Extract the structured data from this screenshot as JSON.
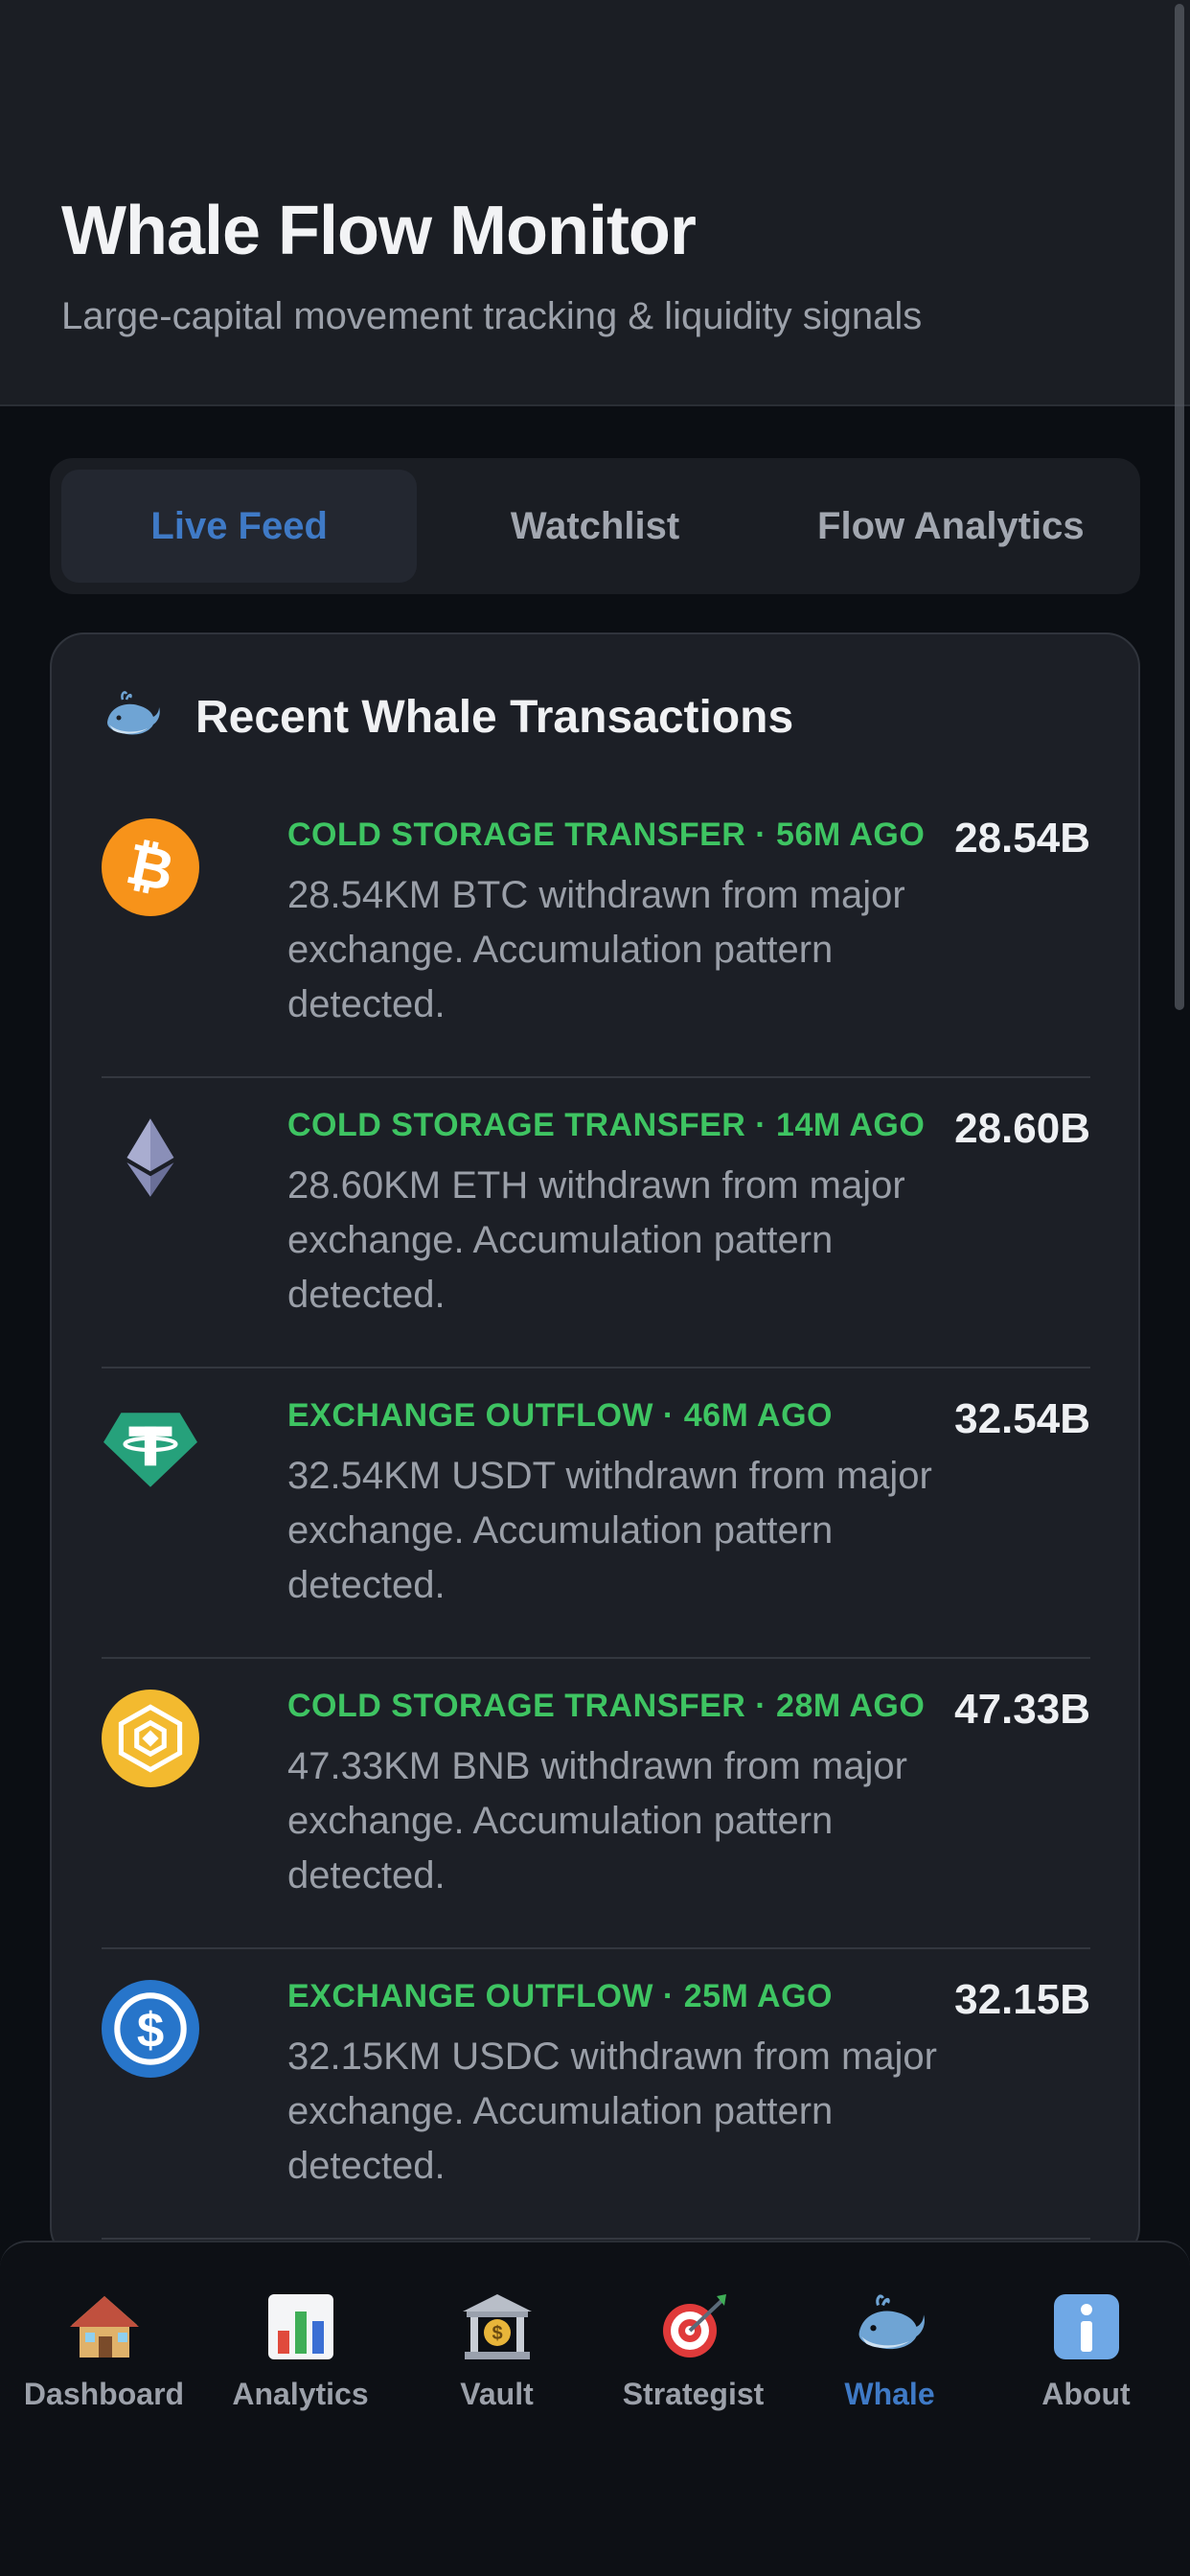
{
  "header": {
    "title": "Whale Flow Monitor",
    "subtitle": "Large-capital movement tracking & liquidity signals"
  },
  "tabs": [
    {
      "label": "Live Feed",
      "active": true
    },
    {
      "label": "Watchlist",
      "active": false
    },
    {
      "label": "Flow Analytics",
      "active": false
    }
  ],
  "card": {
    "title": "Recent Whale Transactions",
    "icon": "whale-icon"
  },
  "transactions": [
    {
      "coin": "btc",
      "icon": "bitcoin-icon",
      "meta": "COLD STORAGE TRANSFER · 56M AGO",
      "desc": "28.54KM BTC withdrawn from major exchange. Accumulation pattern detected.",
      "amount": "28.54B"
    },
    {
      "coin": "eth",
      "icon": "ethereum-icon",
      "meta": "COLD STORAGE TRANSFER · 14M AGO",
      "desc": "28.60KM ETH withdrawn from major exchange. Accumulation pattern detected.",
      "amount": "28.60B"
    },
    {
      "coin": "usdt",
      "icon": "tether-icon",
      "meta": "EXCHANGE OUTFLOW · 46M AGO",
      "desc": "32.54KM USDT withdrawn from major exchange. Accumulation pattern detected.",
      "amount": "32.54B"
    },
    {
      "coin": "bnb",
      "icon": "bnb-icon",
      "meta": "COLD STORAGE TRANSFER · 28M AGO",
      "desc": "47.33KM BNB withdrawn from major exchange. Accumulation pattern detected.",
      "amount": "47.33B"
    },
    {
      "coin": "usdc",
      "icon": "usdc-icon",
      "meta": "EXCHANGE OUTFLOW · 25M AGO",
      "desc": "32.15KM USDC withdrawn from major exchange. Accumulation pattern detected.",
      "amount": "32.15B"
    }
  ],
  "nav": [
    {
      "label": "Dashboard",
      "icon": "house-icon",
      "active": false
    },
    {
      "label": "Analytics",
      "icon": "bar-chart-icon",
      "active": false
    },
    {
      "label": "Vault",
      "icon": "bank-icon",
      "active": false
    },
    {
      "label": "Strategist",
      "icon": "target-icon",
      "active": false
    },
    {
      "label": "Whale",
      "icon": "whale-icon",
      "active": true
    },
    {
      "label": "About",
      "icon": "info-icon",
      "active": false
    }
  ],
  "colors": {
    "accent": "#3f7ac6",
    "positive": "#3ec462",
    "background": "#0b0e13",
    "card": "#1c1f26"
  }
}
